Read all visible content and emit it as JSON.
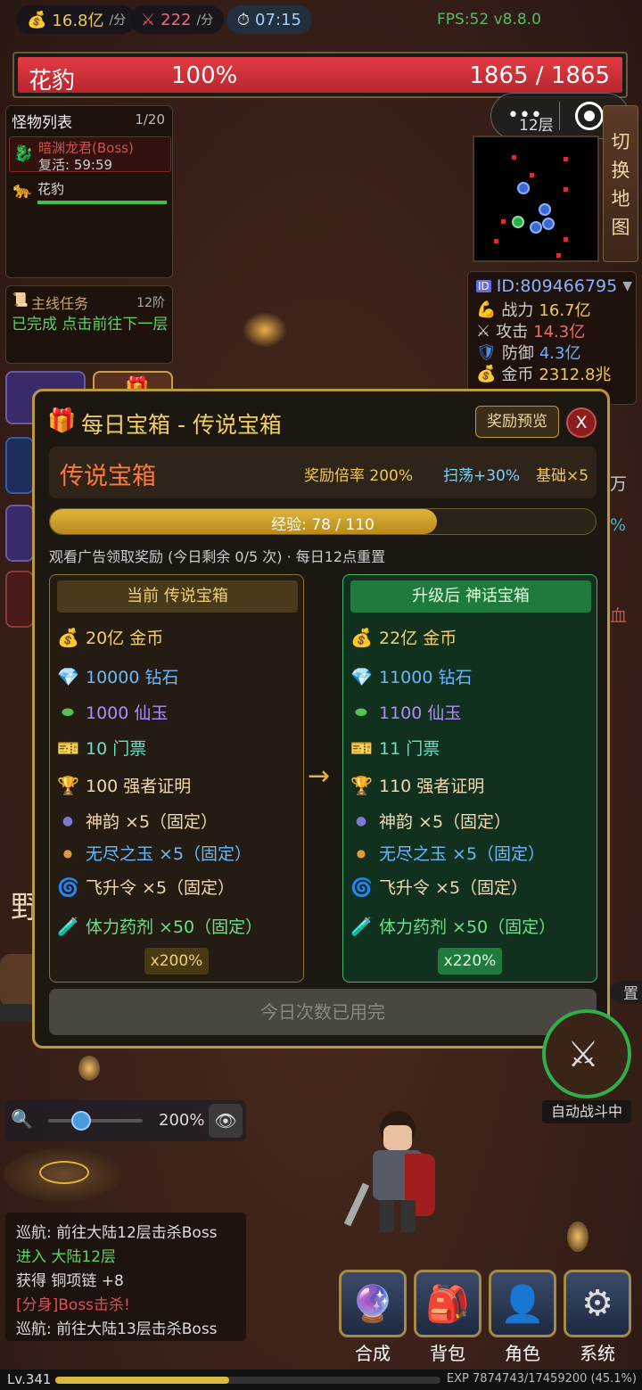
{
  "topbar": {
    "gold_rate": "16.8亿",
    "gold_unit": "/分",
    "attack_rate": "222",
    "attack_unit": "/分",
    "timer": "07:15",
    "fps": "FPS:52 v8.8.0"
  },
  "target": {
    "name": "花豹",
    "percent": "100%",
    "hp": "1865 / 1865"
  },
  "monster_list": {
    "title": "怪物列表",
    "count": "1/20",
    "boss_name": "暗渊龙君(Boss)",
    "boss_respawn": "复活: 59:59",
    "monster_name": "花豹"
  },
  "quest": {
    "title": "主线任务",
    "tier": "12阶",
    "status": "已完成 点击前往下一层"
  },
  "minimap": {
    "floor": "12层",
    "switch_map": "切换地图"
  },
  "player_stats": {
    "id": "ID:809466795",
    "power_label": "战力",
    "power": "16.7亿",
    "attack_label": "攻击",
    "attack": "14.3亿",
    "defense_label": "防御",
    "defense": "4.3亿",
    "gold_label": "金币",
    "gold": "2312.8兆"
  },
  "modal": {
    "title": "每日宝箱 - 传说宝箱",
    "preview_button": "奖励预览",
    "close_label": "X",
    "chest_name": "传说宝箱",
    "reward_rate": "奖励倍率 200%",
    "sweep": "扫荡+30%",
    "base": "基础×5",
    "exp_label": "经验: 78 / 110",
    "exp_progress": 0.709,
    "ad_note": "观看广告领取奖励 (今日剩余 0/5 次) · 每日12点重置",
    "current": {
      "header": "当前 传说宝箱",
      "gold": "20亿 金币",
      "diamond": "10000 钻石",
      "jade": "1000 仙玉",
      "ticket": "10 门票",
      "trophy": "100 强者证明",
      "shenyun": "神韵 ×5（固定）",
      "orb": "无尽之玉 ×5（固定）",
      "ascend": "飞升令 ×5（固定）",
      "potion": "体力药剂 ×50（固定）",
      "multiplier": "x200%"
    },
    "upgraded": {
      "header": "升级后 神话宝箱",
      "gold": "22亿 金币",
      "diamond": "11000 钻石",
      "jade": "1100 仙玉",
      "ticket": "11 门票",
      "trophy": "110 强者证明",
      "shenyun": "神韵 ×5（固定）",
      "orb": "无尽之玉 ×5（固定）",
      "ascend": "飞升令 ×5（固定）",
      "potion": "体力药剂 ×50（固定）",
      "multiplier": "x220%"
    },
    "arrow": "→",
    "claim_button": "今日次数已用完"
  },
  "zoom": {
    "value": "200%",
    "level": 0.35
  },
  "auto_battle": {
    "label": "自动战斗中"
  },
  "logs": [
    {
      "text": "巡航: 前往大陆12层击杀Boss",
      "color": "#d8d8d8"
    },
    {
      "text": "进入 大陆12层",
      "color": "#5fd35f"
    },
    {
      "text": "获得 铜项链 +8",
      "color": "#d8d8d8"
    },
    {
      "text": "[分身]Boss击杀!",
      "color": "#e05050"
    },
    {
      "text": "巡航: 前往大陆13层击杀Boss",
      "color": "#d8d8d8"
    }
  ],
  "nav": {
    "craft": "合成",
    "bag": "背包",
    "character": "角色",
    "system": "系统"
  },
  "footer": {
    "level": "Lv.341",
    "exp": "EXP 7874743/17459200 (45.1%)",
    "exp_progress": 0.451
  },
  "side_fragments": {
    "zone_char": "野",
    "wan": "万",
    "percent_char": "%",
    "blood_char": "血",
    "set_char": "置"
  }
}
